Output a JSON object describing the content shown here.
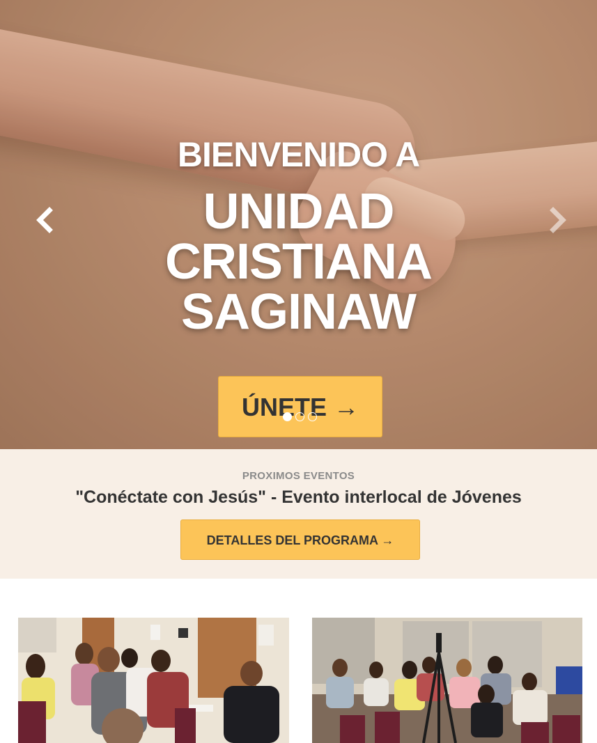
{
  "hero": {
    "kicker": "BIENVENIDO A",
    "title_lines": [
      "UNIDAD",
      "CRISTIANA",
      "SAGINAW"
    ],
    "join_label": "ÚNETE",
    "join_arrow": "→",
    "prev_icon": "chevron-left-icon",
    "next_icon": "chevron-right-icon",
    "slides_count": 3,
    "active_slide": 1
  },
  "events": {
    "kicker": "PROXIMOS EVENTOS",
    "title": "\"Conéctate con Jesús\" - Evento interlocal de Jóvenes",
    "details_label": "DETALLES DEL PROGRAMA →"
  },
  "colors": {
    "accent": "#fcc458",
    "events_bg": "#f8efe6",
    "text_dark": "#333333",
    "text_muted": "#8a8a8a"
  }
}
